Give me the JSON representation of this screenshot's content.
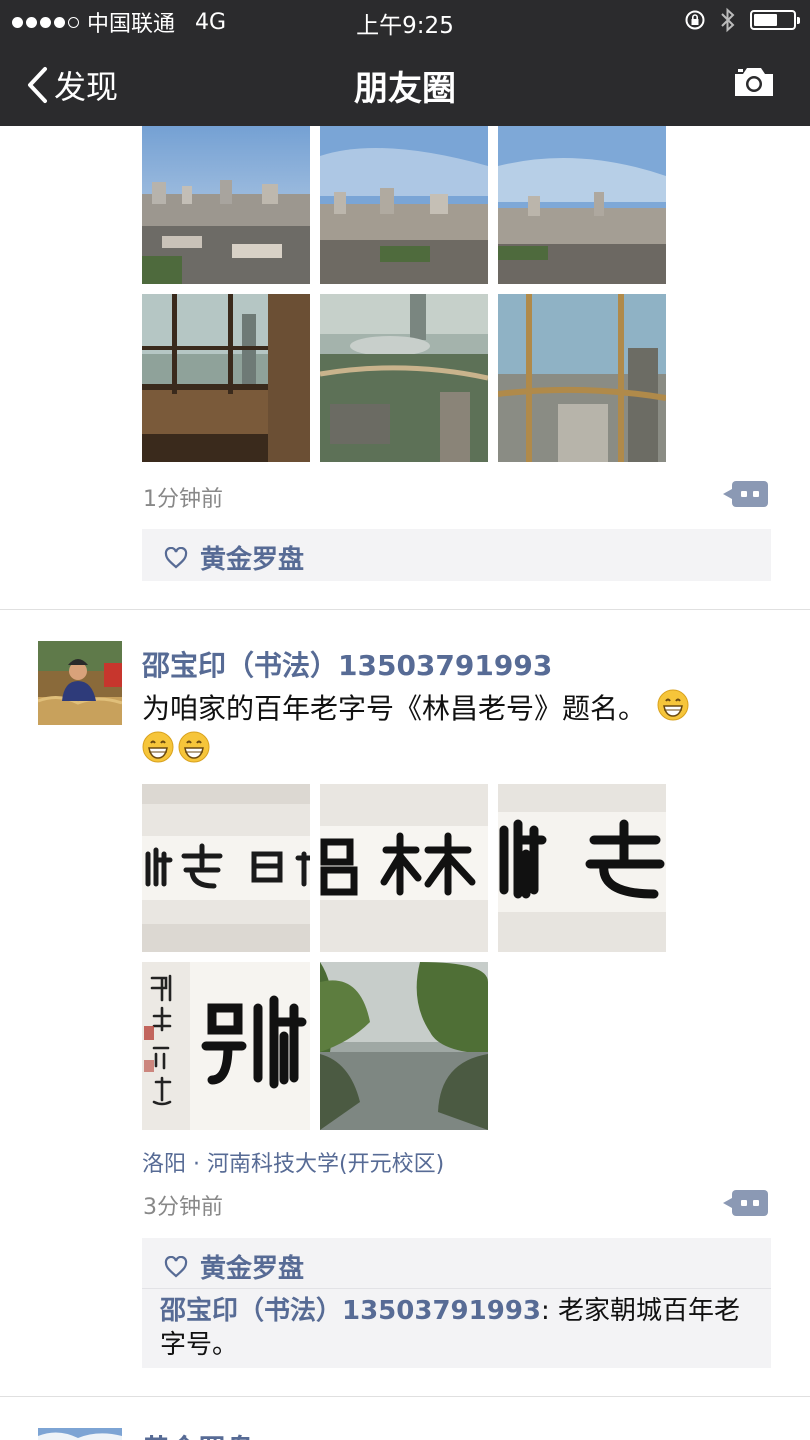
{
  "status": {
    "carrier": "中国联通",
    "network": "4G",
    "time": "上午9:25"
  },
  "nav": {
    "back_label": "发现",
    "title": "朋友圈"
  },
  "posts": [
    {
      "time": "1分钟前",
      "like_name": "黄金罗盘"
    },
    {
      "author": "邵宝印（书法）13503791993",
      "text": "为咱家的百年老字号《林昌老号》题名。",
      "location": "洛阳 · 河南科技大学(开元校区)",
      "time": "3分钟前",
      "like_name": "黄金罗盘",
      "comment": {
        "author": "邵宝印（书法）13503791993",
        "separator": ": ",
        "text": "老家朝城百年老字号。"
      }
    },
    {
      "author": "黄金罗盘"
    }
  ],
  "icons": {
    "camera": "camera-icon",
    "back": "chevron-left-icon",
    "heart": "heart-icon",
    "comment": "comment-icon",
    "emoji": "grinning-face-icon"
  },
  "colors": {
    "bar": "#2b2b2d",
    "link": "#576b95",
    "like_bg": "#f3f3f5"
  }
}
